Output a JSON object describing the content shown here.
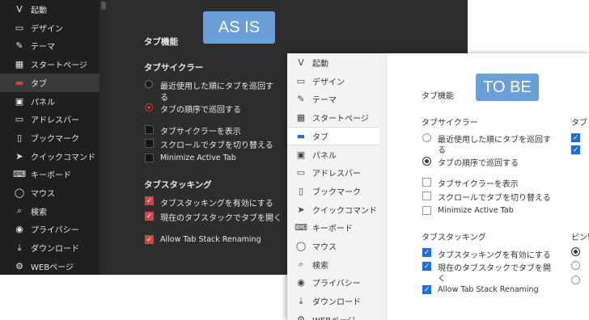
{
  "as_is": {
    "badge": "AS IS",
    "sidebar": [
      {
        "icon": "vivaldi-v-icon",
        "glyph": "V",
        "label": "起動"
      },
      {
        "icon": "folder-icon",
        "glyph": "▭",
        "label": "デザイン"
      },
      {
        "icon": "brush-icon",
        "glyph": "✎",
        "label": "テーマ"
      },
      {
        "icon": "grid-icon",
        "glyph": "▦",
        "label": "スタートページ"
      },
      {
        "icon": "tab-icon",
        "glyph": "▬",
        "label": "タブ"
      },
      {
        "icon": "panel-icon",
        "glyph": "▣",
        "label": "パネル"
      },
      {
        "icon": "address-bar-icon",
        "glyph": "▭",
        "label": "アドレスバー"
      },
      {
        "icon": "bookmark-icon",
        "glyph": "▯",
        "label": "ブックマーク"
      },
      {
        "icon": "quick-command-icon",
        "glyph": "➤",
        "label": "クイックコマンド"
      },
      {
        "icon": "keyboard-icon",
        "glyph": "⌨",
        "label": "キーボード"
      },
      {
        "icon": "mouse-icon",
        "glyph": "◯",
        "label": "マウス"
      },
      {
        "icon": "search-icon",
        "glyph": "⌕",
        "label": "検索"
      },
      {
        "icon": "eye-icon",
        "glyph": "◉",
        "label": "プライバシー"
      },
      {
        "icon": "download-icon",
        "glyph": "⤓",
        "label": "ダウンロード"
      },
      {
        "icon": "web-icon",
        "glyph": "⚙",
        "label": "WEBページ"
      }
    ],
    "section_title": "タブ機能",
    "cycler_heading": "タブサイクラー",
    "radio_1": "最近使用した順にタブを巡回す",
    "radio_1b": "る",
    "radio_2": "タブの順序で巡回する",
    "check_1": "タブサイクラーを表示",
    "check_2": "スクロールでタブを切り替える",
    "check_3": "Minimize Active Tab",
    "stacking_heading": "タブスタッキング",
    "stack_1": "タブスタッキングを有効にする",
    "stack_2": "現在のタブスタックでタブを開く",
    "stack_3": "Allow Tab Stack Renaming"
  },
  "to_be": {
    "badge": "TO BE",
    "sidebar": [
      {
        "icon": "vivaldi-v-icon",
        "glyph": "V",
        "label": "起動"
      },
      {
        "icon": "folder-icon",
        "glyph": "▭",
        "label": "デザイン"
      },
      {
        "icon": "brush-icon",
        "glyph": "✎",
        "label": "テーマ"
      },
      {
        "icon": "grid-icon",
        "glyph": "▦",
        "label": "スタートページ"
      },
      {
        "icon": "tab-icon",
        "glyph": "▬",
        "label": "タブ"
      },
      {
        "icon": "panel-icon",
        "glyph": "▣",
        "label": "パネル"
      },
      {
        "icon": "address-bar-icon",
        "glyph": "▭",
        "label": "アドレスバー"
      },
      {
        "icon": "bookmark-icon",
        "glyph": "▯",
        "label": "ブックマーク"
      },
      {
        "icon": "quick-command-icon",
        "glyph": "➤",
        "label": "クイックコマンド"
      },
      {
        "icon": "keyboard-icon",
        "glyph": "⌨",
        "label": "キーボード"
      },
      {
        "icon": "mouse-icon",
        "glyph": "◯",
        "label": "マウス"
      },
      {
        "icon": "search-icon",
        "glyph": "⌕",
        "label": "検索"
      },
      {
        "icon": "eye-icon",
        "glyph": "◉",
        "label": "プライバシー"
      },
      {
        "icon": "download-icon",
        "glyph": "⤓",
        "label": "ダウンロード"
      },
      {
        "icon": "web-icon",
        "glyph": "⚙",
        "label": "WEBページ"
      }
    ],
    "section_title": "タブ機能",
    "cycler_heading": "タブサイクラー",
    "radio_1": "最近使用した順にタブを巡回す",
    "radio_1b": "る",
    "radio_2": "タブの順序で巡回する",
    "check_1": "タブサイクラーを表示",
    "check_2": "スクロールでタブを切り替える",
    "check_3": "Minimize Active Tab",
    "stacking_heading": "タブスタッキング",
    "stack_1": "タブスタッキングを有効にする",
    "stack_2": "現在のタブスタックでタブを開",
    "stack_2b": "く",
    "stack_3": "Allow Tab Stack Renaming",
    "right_heading_1": "タブ",
    "right_heading_2": "ピン留",
    "accent": "#1e6fd1"
  }
}
